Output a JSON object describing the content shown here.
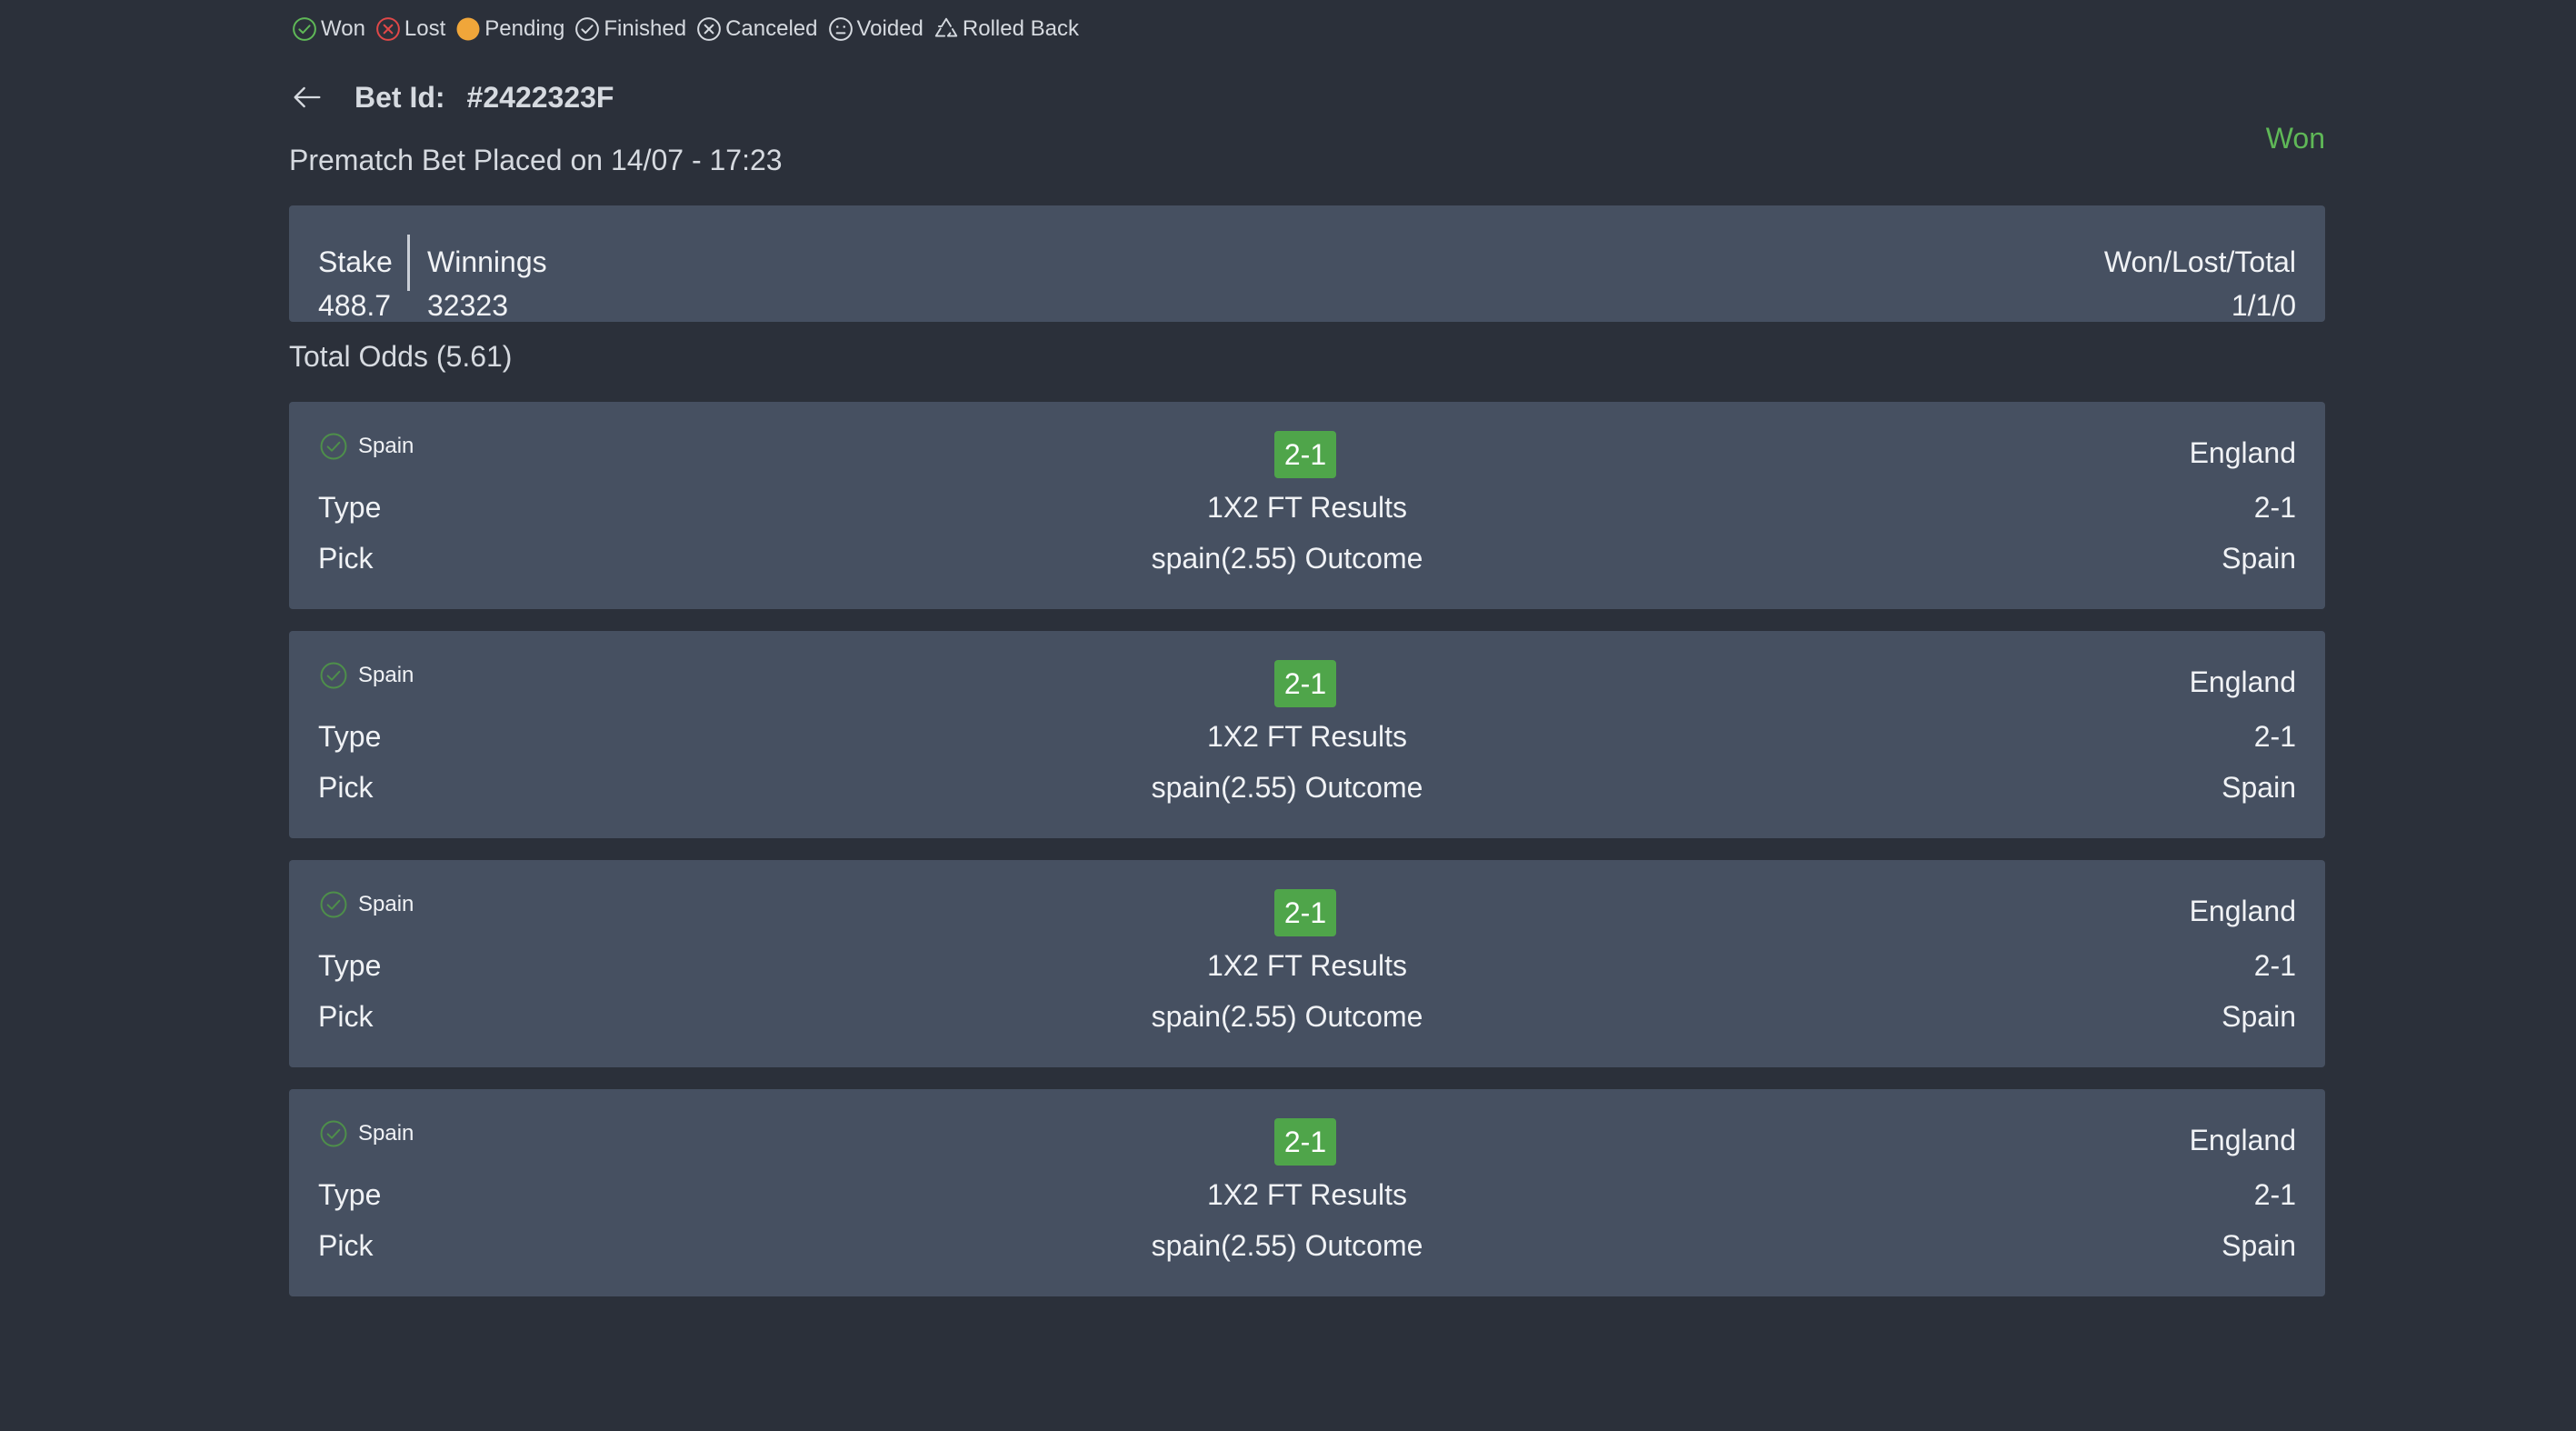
{
  "legend": [
    {
      "icon": "check-circle-icon",
      "label": "Won",
      "color": "#5fb857"
    },
    {
      "icon": "x-circle-icon",
      "label": "Lost",
      "color": "#e04848"
    },
    {
      "icon": "filled-circle-icon",
      "label": "Pending",
      "color": "#f0a63a"
    },
    {
      "icon": "check-circle-icon",
      "label": "Finished",
      "color": "#d6dae0"
    },
    {
      "icon": "x-circle-icon",
      "label": "Canceled",
      "color": "#d6dae0"
    },
    {
      "icon": "neutral-face-icon",
      "label": "Voided",
      "color": "#d6dae0"
    },
    {
      "icon": "recycle-icon",
      "label": "Rolled Back",
      "color": "#d6dae0"
    }
  ],
  "header": {
    "bet_id_label": "Bet Id:",
    "bet_id": "#2422323F",
    "status": "Won",
    "placed": "Prematch Bet Placed on 14/07 - 17:23"
  },
  "summary": {
    "stake_label": "Stake",
    "stake_value": "488.7",
    "winnings_label": "Winnings",
    "winnings_value": "32323",
    "wlt_label": "Won/Lost/Total",
    "wlt_value": "1/1/0"
  },
  "total_odds": "Total Odds (5.61)",
  "selections": [
    {
      "team": "Spain",
      "score": "2-1",
      "opponent": "England",
      "type_label": "Type",
      "type_value": "1X2 FT Results",
      "type_right": "2-1",
      "pick_label": "Pick",
      "pick_value": "spain(2.55) Outcome",
      "pick_right": "Spain"
    },
    {
      "team": "Spain",
      "score": "2-1",
      "opponent": "England",
      "type_label": "Type",
      "type_value": "1X2 FT Results",
      "type_right": "2-1",
      "pick_label": "Pick",
      "pick_value": "spain(2.55) Outcome",
      "pick_right": "Spain"
    },
    {
      "team": "Spain",
      "score": "2-1",
      "opponent": "England",
      "type_label": "Type",
      "type_value": "1X2 FT Results",
      "type_right": "2-1",
      "pick_label": "Pick",
      "pick_value": "spain(2.55) Outcome",
      "pick_right": "Spain"
    },
    {
      "team": "Spain",
      "score": "2-1",
      "opponent": "England",
      "type_label": "Type",
      "type_value": "1X2 FT Results",
      "type_right": "2-1",
      "pick_label": "Pick",
      "pick_value": "spain(2.55) Outcome",
      "pick_right": "Spain"
    }
  ],
  "colors": {
    "background": "#2b303a",
    "card": "#465061",
    "won": "#5fb857",
    "badge": "#4fa54a"
  }
}
